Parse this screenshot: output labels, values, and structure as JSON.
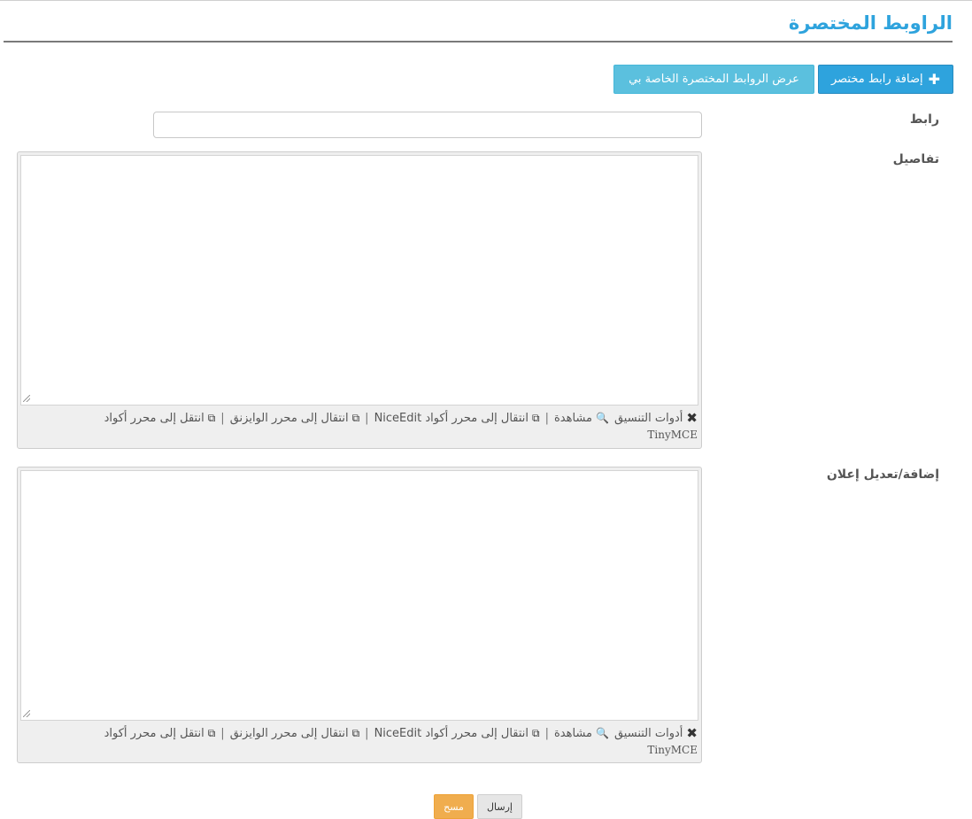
{
  "page": {
    "title": "الراوبط المختصرة"
  },
  "actions": {
    "add_label": "إضافة رابط مختصر",
    "view_label": "عرض الروابط المختصرة الخاصة بي"
  },
  "fields": {
    "link_label": "رابط",
    "link_value": "",
    "details_label": "تفاصيل",
    "ad_label": "إضافة/تعديل إعلان"
  },
  "editor_toolbar": {
    "format_tools": "أدوات التنسيق",
    "preview": "مشاهدة",
    "go_niceedit": "انتقال إلى محرر أكواد NiceEdit",
    "separator": "|",
    "go_wysiwyg": "انتقال إلى محرر الوايزنق",
    "go_tinymce_line1": "انتقل إلى محرر أكواد",
    "go_tinymce_line2": "TinyMCE"
  },
  "icons": {
    "format_tools": "wrench-screwdriver-icon",
    "preview": "search-icon",
    "switch": "window-switch-icon"
  },
  "form_buttons": {
    "submit": "إرسال",
    "clear": "مسح"
  },
  "colors": {
    "title": "#2ea3dd",
    "primary_button": "#2ea3dd",
    "info_button": "#5bc0de",
    "warning_button": "#f0ad4e"
  }
}
